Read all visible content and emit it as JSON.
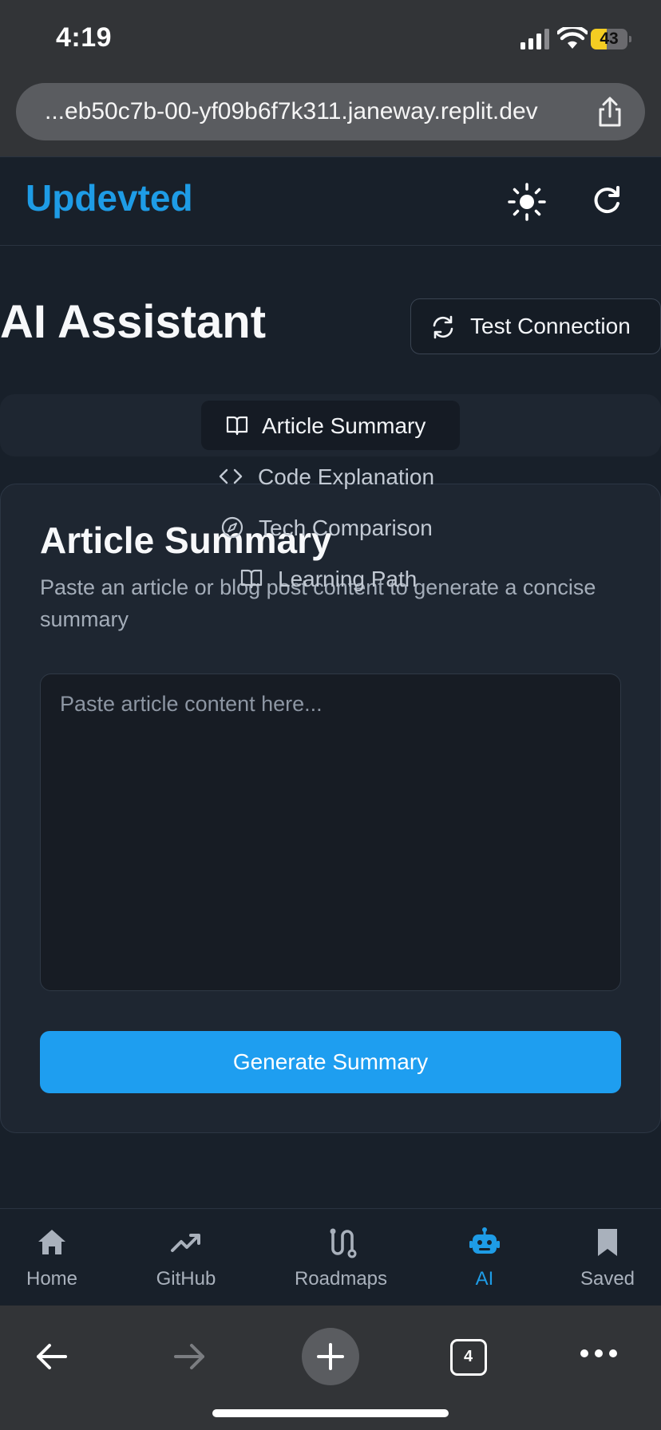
{
  "status_bar": {
    "time": "4:19",
    "battery": "43",
    "battery_level": 0.43
  },
  "browser": {
    "url": "...eb50c7b-00-yf09b6f7k311.janeway.replit.dev",
    "tab_count": "4"
  },
  "header": {
    "brand": "Updevted"
  },
  "page": {
    "title": "AI Assistant",
    "test_connection_label": "Test Connection"
  },
  "tabs": [
    {
      "label": "Article Summary",
      "icon": "book-open-icon",
      "active": true
    },
    {
      "label": "Code Explanation",
      "icon": "code-icon",
      "active": false
    },
    {
      "label": "Tech Comparison",
      "icon": "compass-icon",
      "active": false
    },
    {
      "label": "Learning Path",
      "icon": "book-open-icon",
      "active": false
    }
  ],
  "card": {
    "title": "Article Summary",
    "description": "Paste an article or blog post content to generate a concise summary",
    "textarea_placeholder": "Paste article content here...",
    "textarea_value": "",
    "button_label": "Generate Summary"
  },
  "bottom_nav": [
    {
      "label": "Home",
      "icon": "home-icon",
      "active": false
    },
    {
      "label": "GitHub",
      "icon": "trending-up-icon",
      "active": false
    },
    {
      "label": "Roadmaps",
      "icon": "route-icon",
      "active": false
    },
    {
      "label": "AI",
      "icon": "bot-icon",
      "active": true
    },
    {
      "label": "Saved",
      "icon": "bookmark-icon",
      "active": false
    }
  ],
  "colors": {
    "accent": "#1e9ce6",
    "background": "#18202a",
    "card": "#1e2631",
    "muted_text": "#a4adb9",
    "battery": "#f4cd22"
  }
}
